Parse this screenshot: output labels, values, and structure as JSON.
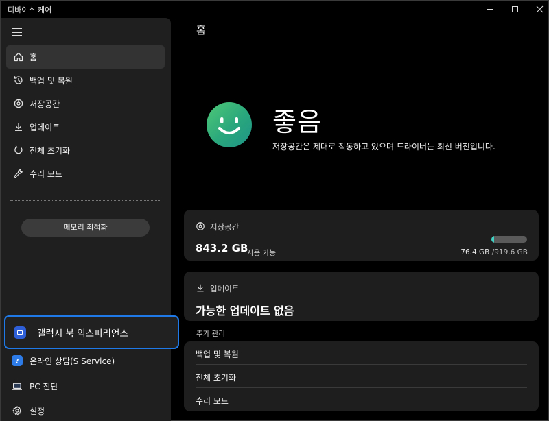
{
  "window": {
    "title": "디바이스 케어"
  },
  "sidebar": {
    "items": [
      {
        "label": "홈",
        "icon": "home-icon",
        "active": true
      },
      {
        "label": "백업 및 복원",
        "icon": "history-icon"
      },
      {
        "label": "저장공간",
        "icon": "storage-icon"
      },
      {
        "label": "업데이트",
        "icon": "download-icon"
      },
      {
        "label": "전체 초기화",
        "icon": "reset-icon"
      },
      {
        "label": "수리 모드",
        "icon": "wrench-icon"
      }
    ],
    "memory_button": "메모리 최적화",
    "experience": {
      "label": "갤럭시 북 익스피리언스",
      "icon": "galaxy-book-icon"
    },
    "bottom_items": [
      {
        "label": "온라인 상담(S Service)",
        "icon": "chat-icon"
      },
      {
        "label": "PC 진단",
        "icon": "pc-diagnosis-icon"
      },
      {
        "label": "설정",
        "icon": "gear-icon"
      }
    ]
  },
  "main": {
    "page_title": "홈",
    "status": {
      "title": "좋음",
      "description": "저장공간은 제대로 작동하고 있으며 드라이버는 최신 버전입니다.",
      "icon": "smiley-icon"
    },
    "storage_card": {
      "title": "저장공간",
      "available": "843.2 GB",
      "available_label": "사용 가능",
      "used": "76.4 GB",
      "total": "/919.6 GB",
      "used_fraction": 0.083
    },
    "update_card": {
      "title": "업데이트",
      "status": "가능한 업데이트 없음"
    },
    "extra": {
      "section_label": "추가 관리",
      "items": [
        "백업 및 복원",
        "전체 초기화",
        "수리 모드"
      ]
    }
  },
  "colors": {
    "accent": "#1f7ae8",
    "good": "#3dbb7a",
    "storage_fill": "#3fd1c3"
  }
}
